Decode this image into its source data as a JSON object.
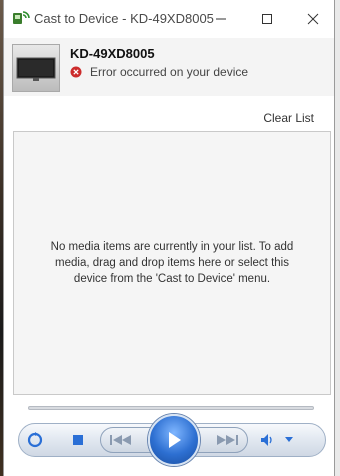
{
  "window": {
    "title": "Cast to Device - KD-49XD8005",
    "minimize_icon": "minimize-icon",
    "maximize_icon": "maximize-icon",
    "close_icon": "close-icon"
  },
  "device": {
    "name": "KD-49XD8005",
    "status": "Error occurred on your device",
    "status_color": "#cc2b2b"
  },
  "list": {
    "clear_label": "Clear List",
    "empty_message": "No media items are currently in your list.  To add media, drag and drop items here or select this device from the 'Cast to Device' menu."
  },
  "controls": {
    "buttons": [
      "shuffle-icon",
      "stop-icon",
      "previous-icon",
      "play-icon",
      "next-icon",
      "volume-icon",
      "chevron-down-icon"
    ],
    "accent": "#2d6fd1"
  }
}
